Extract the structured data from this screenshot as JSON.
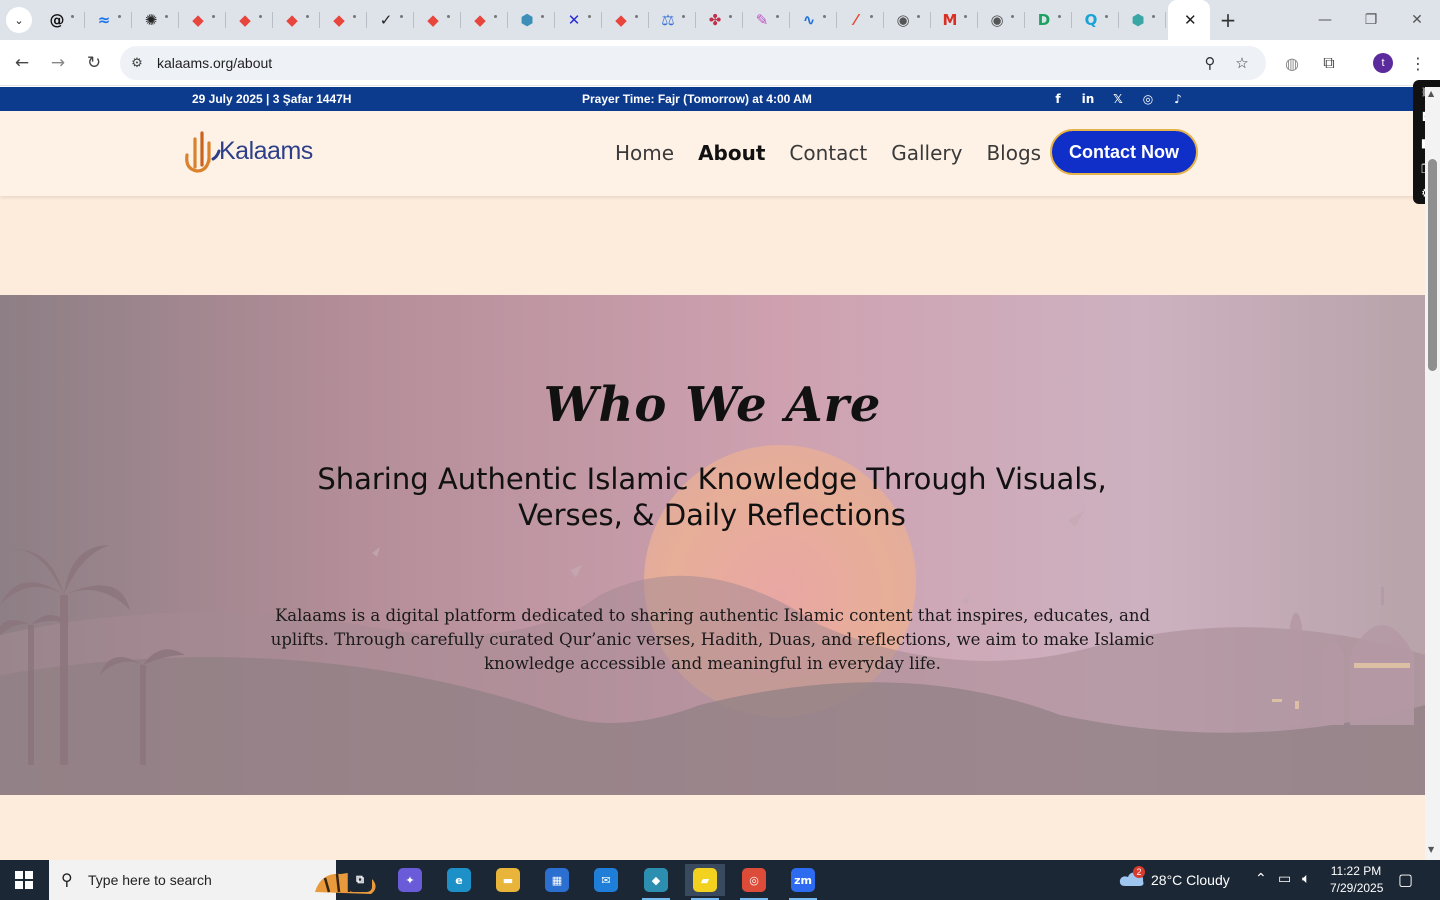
{
  "browser": {
    "tab_favicons": [
      {
        "icon": "threads-icon",
        "color": "#111111",
        "glyph": "@"
      },
      {
        "icon": "wave-icon",
        "color": "#1a73e8",
        "glyph": "≈"
      },
      {
        "icon": "openai-icon",
        "color": "#222222",
        "glyph": "✺"
      },
      {
        "icon": "diamond-icon",
        "color": "#e8453c",
        "glyph": "◆"
      },
      {
        "icon": "diamond-icon",
        "color": "#e8453c",
        "glyph": "◆"
      },
      {
        "icon": "diamond-icon",
        "color": "#e8453c",
        "glyph": "◆"
      },
      {
        "icon": "diamond-icon",
        "color": "#e8453c",
        "glyph": "◆"
      },
      {
        "icon": "check-icon",
        "color": "#222222",
        "glyph": "✓"
      },
      {
        "icon": "diamond-icon",
        "color": "#e8453c",
        "glyph": "◆"
      },
      {
        "icon": "diamond-icon",
        "color": "#e8453c",
        "glyph": "◆"
      },
      {
        "icon": "hexagon-icon",
        "color": "#3d8fb8",
        "glyph": "⬢"
      },
      {
        "icon": "x-tool-icon",
        "color": "#2a2ad8",
        "glyph": "✕"
      },
      {
        "icon": "diamond-icon",
        "color": "#e8453c",
        "glyph": "◆"
      },
      {
        "icon": "scale-icon",
        "color": "#3b6fd4",
        "glyph": "⚖"
      },
      {
        "icon": "clover-icon",
        "color": "#c0304a",
        "glyph": "✤"
      },
      {
        "icon": "brush-icon",
        "color": "#c04fc7",
        "glyph": "✎"
      },
      {
        "icon": "pulse-icon",
        "color": "#1f6fd9",
        "glyph": "∿"
      },
      {
        "icon": "pen-icon",
        "color": "#e8452c",
        "glyph": "⁄"
      },
      {
        "icon": "globe-icon",
        "color": "#555555",
        "glyph": "◉"
      },
      {
        "icon": "gmail-icon",
        "color": "#d93025",
        "glyph": "M"
      },
      {
        "icon": "globe-icon",
        "color": "#555555",
        "glyph": "◉"
      },
      {
        "icon": "d-icon",
        "color": "#1aa260",
        "glyph": "D"
      },
      {
        "icon": "search-q-icon",
        "color": "#1ba3d6",
        "glyph": "Q"
      },
      {
        "icon": "hexagon-icon",
        "color": "#3aa6a6",
        "glyph": "⬢"
      }
    ],
    "active_tab_close": "✕",
    "new_tab": "+",
    "url": "kalaams.org/about",
    "profile_initial": "t"
  },
  "site": {
    "topbar": {
      "date": "29 July 2025 | 3 Şafar 1447H",
      "prayer_prefix": "Prayer Time: ",
      "prayer_name": "Fajr (Tomorrow)",
      "prayer_suffix": " at 4:00 AM",
      "social": [
        {
          "icon": "facebook-icon",
          "glyph": "f"
        },
        {
          "icon": "linkedin-icon",
          "glyph": "in"
        },
        {
          "icon": "x-twitter-icon",
          "glyph": "𝕏"
        },
        {
          "icon": "instagram-icon",
          "glyph": "◎"
        },
        {
          "icon": "tiktok-icon",
          "glyph": "♪"
        }
      ]
    },
    "logo_text": "Kalaams",
    "nav": [
      "Home",
      "About",
      "Contact",
      "Gallery",
      "Blogs"
    ],
    "nav_active": "About",
    "cta": "Contact Now",
    "hero": {
      "title": "Who We Are",
      "subtitle": "Sharing Authentic Islamic Knowledge Through Visuals, Verses, & Daily Reflections",
      "body": "Kalaams is a digital platform dedicated to sharing authentic Islamic content that inspires, educates, and uplifts. Through carefully curated Qur’anic verses, Hadith, Duas, and reflections, we aim to make Islamic knowledge accessible and meaningful in everyday life."
    }
  },
  "taskbar": {
    "search_placeholder": "Type here to search",
    "weather": "28°C  Cloudy",
    "weather_badge": "2",
    "time": "11:22 PM",
    "date": "7/29/2025",
    "apps": [
      {
        "name": "task-view-icon",
        "color": "#1c2735",
        "glyph": "⧉",
        "running": false
      },
      {
        "name": "copilot-icon",
        "color": "#6a5cd8",
        "glyph": "✦",
        "running": false
      },
      {
        "name": "edge-icon",
        "color": "#1e90c8",
        "glyph": "e",
        "running": false
      },
      {
        "name": "file-explorer-icon",
        "color": "#e8b53a",
        "glyph": "▬",
        "running": false
      },
      {
        "name": "store-icon",
        "color": "#2b6fd1",
        "glyph": "▦",
        "running": false
      },
      {
        "name": "mail-icon",
        "color": "#1f7fd8",
        "glyph": "✉",
        "running": false
      },
      {
        "name": "app-diamond-icon",
        "color": "#2d8fb0",
        "glyph": "◆",
        "running": true
      },
      {
        "name": "sticky-notes-icon",
        "color": "#f2d21f",
        "glyph": "▰",
        "running": true
      },
      {
        "name": "chrome-icon",
        "color": "#dd4b39",
        "glyph": "◎",
        "running": true
      },
      {
        "name": "zoom-icon",
        "color": "#2d6cf0",
        "glyph": "zm",
        "running": true
      }
    ]
  }
}
